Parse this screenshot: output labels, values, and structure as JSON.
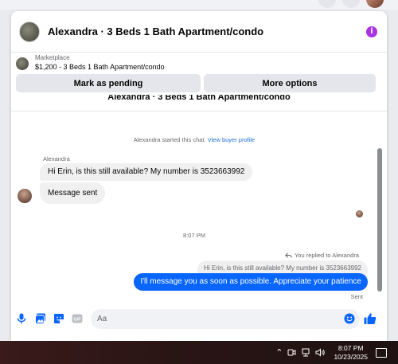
{
  "header": {
    "title": "Alexandra · 3 Beds 1 Bath Apartment/condo",
    "info_symbol": "i"
  },
  "listing": {
    "label": "Marketplace",
    "description": "$1,200 - 3 Beds 1 Bath Apartment/condo",
    "pending_button": "Mark as pending",
    "more_button": "More options"
  },
  "thread": {
    "cut_title": "Alexandra · 3 Beds 1 Bath Apartment/condo",
    "started_text": "Alexandra started this chat.",
    "buyer_profile_link": "View buyer profile",
    "sender_name": "Alexandra",
    "incoming_message": "Hi Erin, is this still available? My number is 3523663992",
    "incoming_message_2": "Message sent",
    "timestamp": "8:07 PM",
    "replied_label": "You replied to Alexandra",
    "quoted_message": "Hi Erin, is this still available? My number is 3523663992",
    "outgoing_message": "I'll message you as soon as possible. Appreciate your patience",
    "status": "Sent"
  },
  "composer": {
    "placeholder": "Aa",
    "gif_label": "GIF"
  },
  "taskbar": {
    "time": "8:07 PM",
    "date": "10/23/2025"
  },
  "colors": {
    "accent": "#0866ff",
    "info": "#a933e0",
    "link": "#216fdb"
  }
}
